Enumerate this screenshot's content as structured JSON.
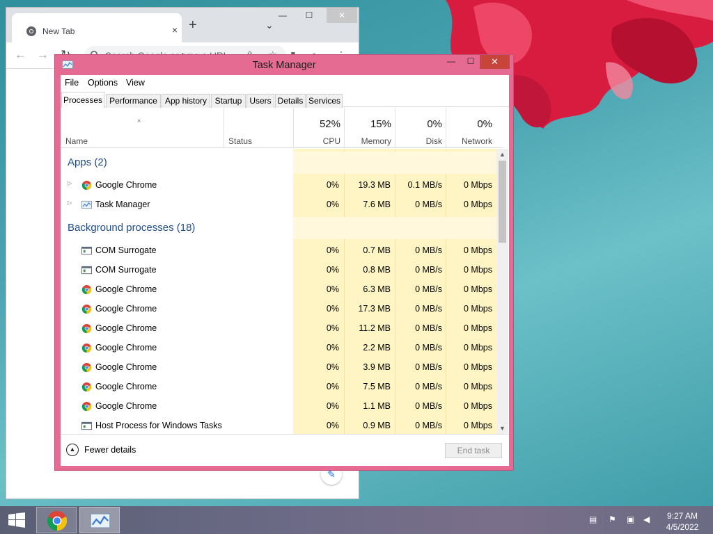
{
  "chrome": {
    "tab_title": "New Tab",
    "tab_close": "×",
    "new_tab": "+",
    "tab_search": "⌄",
    "minimize": "—",
    "maximize": "☐",
    "close": "✕",
    "back": "←",
    "forward": "→",
    "reload": "↻",
    "omnibox_placeholder": "Search Google or type a URL",
    "share_icon": "⇪",
    "star_icon": "☆",
    "sidepanel_icon": "▮",
    "profile_icon": "●",
    "menu_icon": "⋮",
    "customize_icon": "✎"
  },
  "task_manager": {
    "title": "Task Manager",
    "caption": {
      "minimize": "—",
      "maximize": "☐",
      "close": "✕"
    },
    "menu": [
      "File",
      "Options",
      "View"
    ],
    "tabs": [
      {
        "label": "Processes",
        "active": true
      },
      {
        "label": "Performance",
        "active": false
      },
      {
        "label": "App history",
        "active": false
      },
      {
        "label": "Startup",
        "active": false
      },
      {
        "label": "Users",
        "active": false
      },
      {
        "label": "Details",
        "active": false
      },
      {
        "label": "Services",
        "active": false
      }
    ],
    "columns": {
      "sort_caret": "˄",
      "name": "Name",
      "status": "Status",
      "cpu_pct": "52%",
      "cpu": "CPU",
      "memory_pct": "15%",
      "memory": "Memory",
      "disk_pct": "0%",
      "disk": "Disk",
      "network_pct": "0%",
      "network": "Network"
    },
    "groups": {
      "apps": "Apps (2)",
      "background": "Background processes (18)"
    },
    "apps": [
      {
        "name": "Google Chrome",
        "icon": "chrome-icon",
        "cpu": "0%",
        "memory": "19.3 MB",
        "disk": "0.1 MB/s",
        "network": "0 Mbps"
      },
      {
        "name": "Task Manager",
        "icon": "task-manager-icon",
        "cpu": "0%",
        "memory": "7.6 MB",
        "disk": "0 MB/s",
        "network": "0 Mbps"
      }
    ],
    "background": [
      {
        "name": "COM Surrogate",
        "icon": "window-icon",
        "cpu": "0%",
        "memory": "0.7 MB",
        "disk": "0 MB/s",
        "network": "0 Mbps"
      },
      {
        "name": "COM Surrogate",
        "icon": "window-icon",
        "cpu": "0%",
        "memory": "0.8 MB",
        "disk": "0 MB/s",
        "network": "0 Mbps"
      },
      {
        "name": "Google Chrome",
        "icon": "chrome-icon",
        "cpu": "0%",
        "memory": "6.3 MB",
        "disk": "0 MB/s",
        "network": "0 Mbps"
      },
      {
        "name": "Google Chrome",
        "icon": "chrome-icon",
        "cpu": "0%",
        "memory": "17.3 MB",
        "disk": "0 MB/s",
        "network": "0 Mbps"
      },
      {
        "name": "Google Chrome",
        "icon": "chrome-icon",
        "cpu": "0%",
        "memory": "11.2 MB",
        "disk": "0 MB/s",
        "network": "0 Mbps"
      },
      {
        "name": "Google Chrome",
        "icon": "chrome-icon",
        "cpu": "0%",
        "memory": "2.2 MB",
        "disk": "0 MB/s",
        "network": "0 Mbps"
      },
      {
        "name": "Google Chrome",
        "icon": "chrome-icon",
        "cpu": "0%",
        "memory": "3.9 MB",
        "disk": "0 MB/s",
        "network": "0 Mbps"
      },
      {
        "name": "Google Chrome",
        "icon": "chrome-icon",
        "cpu": "0%",
        "memory": "7.5 MB",
        "disk": "0 MB/s",
        "network": "0 Mbps"
      },
      {
        "name": "Google Chrome",
        "icon": "chrome-icon",
        "cpu": "0%",
        "memory": "1.1 MB",
        "disk": "0 MB/s",
        "network": "0 Mbps"
      },
      {
        "name": "Host Process for Windows Tasks",
        "icon": "window-icon",
        "cpu": "0%",
        "memory": "0.9 MB",
        "disk": "0 MB/s",
        "network": "0 Mbps"
      }
    ],
    "fewer_details": "Fewer details",
    "end_task": "End task",
    "scroll_up": "▲",
    "scroll_down": "▼"
  },
  "taskbar": {
    "time": "9:27 AM",
    "date": "4/5/2022",
    "tray_icons": [
      "action-center-icon",
      "flag-alert-icon",
      "network-icon",
      "volume-muted-icon"
    ]
  },
  "colors": {
    "tm_frame": "#e66b93",
    "heat_cell": "#fff4c4",
    "group_text": "#1e4d8c",
    "close_button": "#c7443a"
  }
}
